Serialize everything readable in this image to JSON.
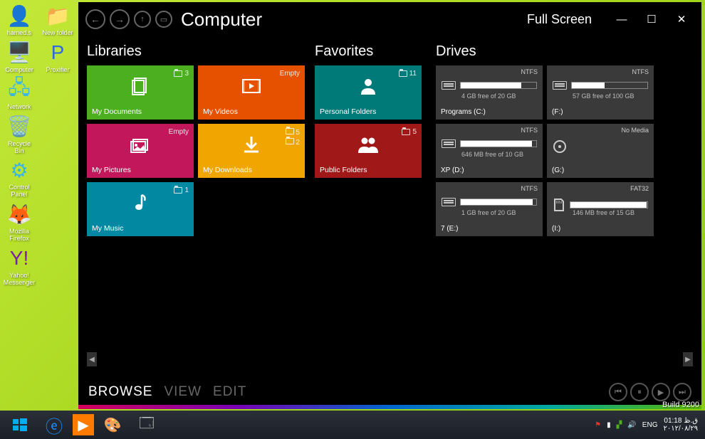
{
  "desktop": {
    "icons": [
      [
        {
          "label": "hamed.s",
          "glyph": "👤",
          "color": "#3bb4e8"
        },
        {
          "label": "New folder",
          "glyph": "📁",
          "color": "#3bb4e8"
        }
      ],
      [
        {
          "label": "Computer",
          "glyph": "🖥️",
          "color": "#3bb4e8"
        },
        {
          "label": "Proxifier",
          "glyph": "P",
          "color": "#2b6dd8"
        }
      ],
      [
        {
          "label": "Network",
          "glyph": "🖧",
          "color": "#3bb4e8"
        }
      ],
      [
        {
          "label": "Recycle Bin",
          "glyph": "🗑️",
          "color": "#3dd070"
        }
      ],
      [
        {
          "label": "Control Panel",
          "glyph": "⚙",
          "color": "#3bb4e8"
        }
      ],
      [
        {
          "label": "Mozilla Firefox",
          "glyph": "🦊",
          "color": "#e66000"
        }
      ],
      [
        {
          "label": "Yahoo! Messenger",
          "glyph": "Y!",
          "color": "#7b1fa2"
        }
      ]
    ]
  },
  "window": {
    "title": "Computer",
    "fullscreen_label": "Full Screen",
    "sections": {
      "libraries": "Libraries",
      "favorites": "Favorites",
      "drives": "Drives"
    },
    "libraries": [
      {
        "name": "My Documents",
        "color": "#4caf1f",
        "meta": "3",
        "icon": "docs"
      },
      {
        "name": "My Videos",
        "color": "#e65100",
        "meta": "Empty",
        "icon": "video"
      },
      {
        "name": "My Pictures",
        "color": "#c2185b",
        "meta": "Empty",
        "icon": "pics"
      },
      {
        "name": "My Downloads",
        "color": "#f0a500",
        "meta2": [
          "5",
          "2"
        ],
        "icon": "dl"
      },
      {
        "name": "My Music",
        "color": "#0288a0",
        "meta": "1",
        "icon": "music"
      }
    ],
    "favorites": [
      {
        "name": "Personal Folders",
        "color": "#007a78",
        "meta": "11",
        "icon": "user"
      },
      {
        "name": "Public Folders",
        "color": "#a01818",
        "meta": "5",
        "icon": "users"
      }
    ],
    "drives": [
      {
        "label": "Programs (C:)",
        "fs": "NTFS",
        "free": "4 GB free of 20 GB",
        "pct": 80,
        "icon": "hdd"
      },
      {
        "label": "(F:)",
        "fs": "NTFS",
        "free": "57 GB free of 100 GB",
        "pct": 43,
        "icon": "hdd"
      },
      {
        "label": "XP (D:)",
        "fs": "NTFS",
        "free": "646 MB free of 10 GB",
        "pct": 94,
        "icon": "hdd"
      },
      {
        "label": "(G:)",
        "fs": "No Media",
        "free": "",
        "pct": 0,
        "icon": "disc"
      },
      {
        "label": "7 (E:)",
        "fs": "NTFS",
        "free": "1 GB free of 20 GB",
        "pct": 95,
        "icon": "hdd"
      },
      {
        "label": "(I:)",
        "fs": "FAT32",
        "free": "146 MB free of 15 GB",
        "pct": 99,
        "icon": "sd"
      }
    ],
    "modes": [
      "BROWSE",
      "VIEW",
      "EDIT"
    ],
    "active_mode": 0
  },
  "build": "Build 9200",
  "taskbar": {
    "tray": {
      "lang": "ENG",
      "time": "01:18",
      "date": "۲۰۱۲/۰۸/۲۹",
      "period": "ق.ظ"
    }
  }
}
